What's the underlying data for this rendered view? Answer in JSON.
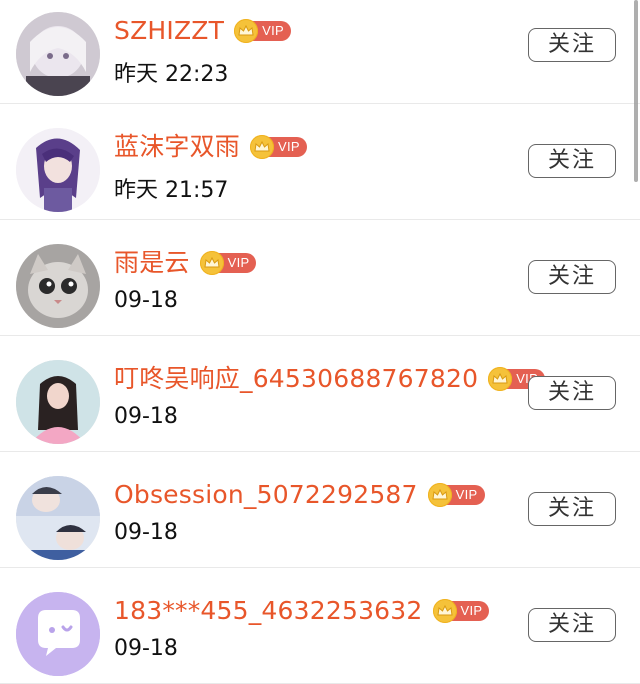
{
  "follow_label": "关注",
  "vip_label": "VIP",
  "colors": {
    "name": "#e8562a",
    "vip_tag": "#e46052",
    "crown": "#f5c23a"
  },
  "users": [
    {
      "name": "SZHIZZT",
      "time": "昨天 22:23",
      "avatar": "anime-girl-white-hair-avatar"
    },
    {
      "name": "蓝沫字双雨",
      "time": "昨天 21:57",
      "avatar": "anime-boy-purple-hair-avatar"
    },
    {
      "name": "雨是云",
      "time": "09-18",
      "avatar": "cat-photo-avatar"
    },
    {
      "name": "叮咚吴响应_64530688767820",
      "time": "09-18",
      "avatar": "girl-photo-avatar"
    },
    {
      "name": "Obsession_5072292587",
      "time": "09-18",
      "avatar": "couple-photo-avatar"
    },
    {
      "name": "183***455_4632253632",
      "time": "09-18",
      "avatar": "default-chat-bubble-avatar"
    }
  ]
}
